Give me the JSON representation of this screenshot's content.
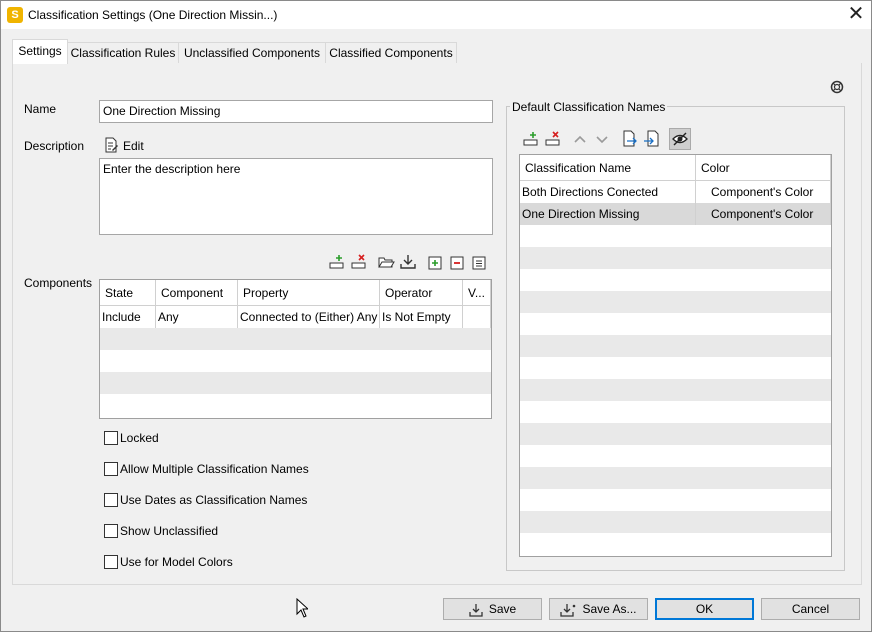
{
  "window": {
    "title": "Classification Settings (One Direction Missin...)",
    "app_icon_letter": "S"
  },
  "tabs": [
    {
      "label": "Settings",
      "active": true
    },
    {
      "label": "Classification Rules",
      "active": false
    },
    {
      "label": "Unclassified Components",
      "active": false
    },
    {
      "label": "Classified Components",
      "active": false
    }
  ],
  "settings": {
    "name_label": "Name",
    "name_value": "One Direction Missing",
    "description_label": "Description",
    "edit_label": "Edit",
    "description_value": "Enter the description here",
    "components_label": "Components"
  },
  "components_table": {
    "headers": [
      "State",
      "Component",
      "Property",
      "Operator",
      "V..."
    ],
    "rows": [
      {
        "state": "Include",
        "component": "Any",
        "property": "Connected to (Either) Any",
        "operator": "Is Not Empty",
        "value": ""
      }
    ]
  },
  "options": [
    {
      "label": "Locked",
      "checked": false
    },
    {
      "label": "Allow Multiple Classification Names",
      "checked": false
    },
    {
      "label": "Use Dates as Classification Names",
      "checked": false
    },
    {
      "label": "Show Unclassified",
      "checked": false
    },
    {
      "label": "Use for Model Colors",
      "checked": false
    }
  ],
  "default_names": {
    "group_label": "Default Classification Names",
    "headers": [
      "Classification Name",
      "Color"
    ],
    "rows": [
      {
        "name": "Both Directions Conected",
        "color": "Component's Color",
        "selected": false
      },
      {
        "name": "One Direction Missing",
        "color": "Component's Color",
        "selected": true
      }
    ]
  },
  "footer": {
    "save_label": "Save",
    "save_as_label": "Save As...",
    "ok_label": "OK",
    "cancel_label": "Cancel"
  },
  "colors": {
    "accent": "#0078d7",
    "selected_row": "#d9d9d9",
    "stripe": "#e9e9e9",
    "app_icon": "#f0b400"
  }
}
